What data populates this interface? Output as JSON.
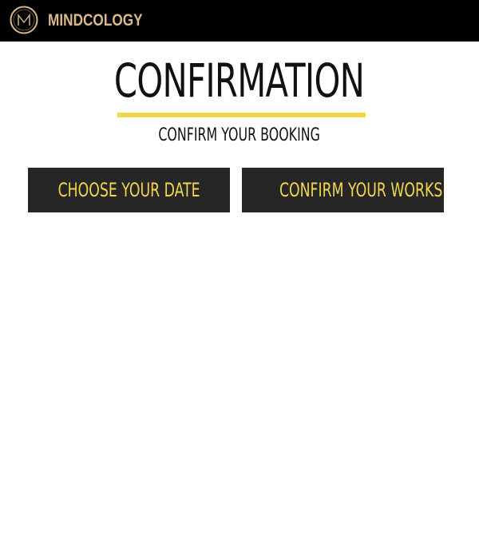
{
  "header": {
    "brand": "MINDCOLOGY",
    "logo_icon": "mindcology-logo-icon",
    "background": "#000000",
    "brand_color": "#d9b98c"
  },
  "main": {
    "title": "CONFIRMATION",
    "subtitle": "CONFIRM YOUR BOOKING",
    "accent_color": "#f3d64a",
    "buttons": {
      "choose_date": "CHOOSE YOUR DATE",
      "confirm_workshop": "CONFIRM YOUR WORKSHOP"
    },
    "button_background": "#262626"
  }
}
